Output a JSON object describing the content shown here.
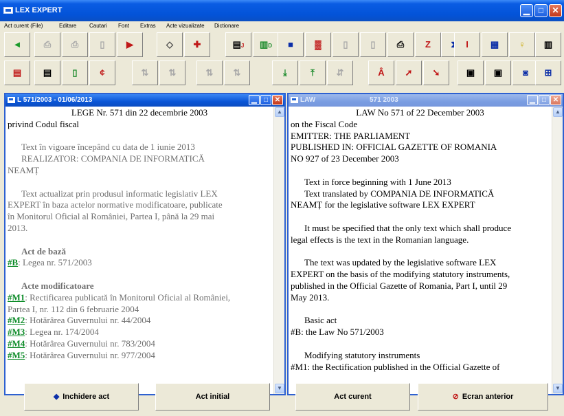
{
  "window": {
    "title": "LEX EXPERT"
  },
  "menu": [
    "Act curent (File)",
    "Editare",
    "Cautari",
    "Font",
    "Extras",
    "Acte vizualizate",
    "Dictionare"
  ],
  "toolbar1": [
    {
      "glyph": "◄",
      "color": "#1a9a2a",
      "dim": false
    },
    {
      "glyph": "⎙",
      "color": "#a8a8a8",
      "dim": true
    },
    {
      "glyph": "⎙",
      "color": "#a8a8a8",
      "dim": true
    },
    {
      "glyph": "▯",
      "color": "#a8a8a8",
      "dim": true
    },
    {
      "glyph": "▶",
      "color": "#c01818",
      "dim": false
    },
    {
      "glyph": "◇",
      "color": "#444444",
      "dim": false
    },
    {
      "glyph": "✚",
      "color": "#c01818",
      "dim": false
    },
    {
      "glyph": "▤",
      "color": "#000000",
      "dim": false,
      "sub": "J"
    },
    {
      "glyph": "▥",
      "color": "#1a8a2a",
      "dim": false,
      "sub": "D"
    },
    {
      "glyph": "■",
      "color": "#0c2fa8",
      "dim": false
    },
    {
      "glyph": "▓",
      "color": "#c01818",
      "dim": false
    },
    {
      "glyph": "▯",
      "color": "#a8a8a8",
      "dim": true
    },
    {
      "glyph": "▯",
      "color": "#a8a8a8",
      "dim": true
    },
    {
      "glyph": "⎙",
      "color": "#000000",
      "dim": false
    },
    {
      "glyph": "Z",
      "color": "#c01818",
      "dim": false
    },
    {
      "glyph": "⧗",
      "color": "#0c2fa8",
      "dim": false
    },
    {
      "glyph": "I",
      "color": "#c01818",
      "dim": false
    },
    {
      "glyph": "▦",
      "color": "#0c2fa8",
      "dim": false
    },
    {
      "glyph": "♀",
      "color": "#c9a700",
      "dim": false
    },
    {
      "glyph": "▥",
      "color": "#000000",
      "dim": false
    }
  ],
  "toolbar2": [
    {
      "glyph": "▤",
      "color": "#c01818",
      "dim": false
    },
    {
      "glyph": "▤",
      "color": "#000000",
      "dim": false
    },
    {
      "glyph": "▯",
      "color": "#1a8a2a",
      "dim": false
    },
    {
      "glyph": "¢",
      "color": "#c01818",
      "dim": false
    },
    {
      "glyph": "⇅",
      "color": "#a8a8a8",
      "dim": true
    },
    {
      "glyph": "⇅",
      "color": "#a8a8a8",
      "dim": true
    },
    {
      "glyph": "⇅",
      "color": "#a8a8a8",
      "dim": true
    },
    {
      "glyph": "⇅",
      "color": "#a8a8a8",
      "dim": true
    },
    {
      "glyph": "⤓",
      "color": "#1a8a2a",
      "dim": false
    },
    {
      "glyph": "⤒",
      "color": "#1a8a2a",
      "dim": false
    },
    {
      "glyph": "⇵",
      "color": "#a8a8a8",
      "dim": true
    },
    {
      "glyph": "Â",
      "color": "#c01818",
      "dim": false
    },
    {
      "glyph": "➚",
      "color": "#c01818",
      "dim": false
    },
    {
      "glyph": "➘",
      "color": "#c01818",
      "dim": false
    },
    {
      "glyph": "▣",
      "color": "#000000",
      "dim": false
    },
    {
      "glyph": "▣",
      "color": "#000000",
      "dim": false
    },
    {
      "glyph": "◙",
      "color": "#0c2fa8",
      "dim": false
    },
    {
      "glyph": "⊞",
      "color": "#0c2fa8",
      "dim": false
    }
  ],
  "left_doc": {
    "title": "L 571/2003 - 01/06/2013",
    "lines": [
      {
        "text": "LEGE   Nr. 571 din 22 decembrie 2003",
        "style": "center"
      },
      {
        "text": "privind Codul fiscal",
        "style": ""
      },
      {
        "text": "",
        "style": ""
      },
      {
        "text": "Text în vigoare începând cu data de 1 iunie 2013",
        "style": "gray indent"
      },
      {
        "text": "REALIZATOR: COMPANIA DE INFORMATICĂ",
        "style": "gray indent"
      },
      {
        "text": "NEAMȚ",
        "style": "gray"
      },
      {
        "text": "",
        "style": ""
      },
      {
        "text": "Text actualizat prin produsul informatic legislativ LEX",
        "style": "gray indent"
      },
      {
        "text": "EXPERT în baza actelor normative modificatoare, publicate",
        "style": "gray"
      },
      {
        "text": "în Monitorul Oficial al României, Partea I, până la 29 mai",
        "style": "gray"
      },
      {
        "text": "2013.",
        "style": "gray"
      },
      {
        "text": "",
        "style": ""
      },
      {
        "text": "Act de bază",
        "style": "bold-gray indent"
      },
      {
        "link": "#B",
        "rest": ": Legea nr. 571/2003"
      },
      {
        "text": "",
        "style": ""
      },
      {
        "text": "Acte modificatoare",
        "style": "bold-gray indent"
      },
      {
        "link": "#M1",
        "rest": ": Rectificarea publicată în Monitorul Oficial al României,"
      },
      {
        "text": "Partea I, nr. 112 din 6 februarie 2004",
        "style": "gray"
      },
      {
        "link": "#M2",
        "rest": ": Hotărârea Guvernului nr. 44/2004"
      },
      {
        "link": "#M3",
        "rest": ": Legea nr. 174/2004"
      },
      {
        "link": "#M4",
        "rest": ": Hotărârea Guvernului nr. 783/2004"
      },
      {
        "link": "#M5",
        "rest": ": Hotărârea Guvernului nr. 977/2004"
      }
    ]
  },
  "right_doc": {
    "title": "LAW",
    "title_number": "571  2003",
    "lines": [
      {
        "text": "LAW   No 571 of 22 December 2003",
        "style": "center"
      },
      {
        "text": "on the Fiscal Code",
        "style": ""
      },
      {
        "text": "EMITTER:     THE PARLIAMENT",
        "style": ""
      },
      {
        "text": "PUBLISHED  IN: OFFICIAL GAZETTE OF ROMANIA",
        "style": ""
      },
      {
        "text": "NO 927 of 23 December 2003",
        "style": ""
      },
      {
        "text": "",
        "style": ""
      },
      {
        "text": "Text in force beginning with 1 June 2013",
        "style": "indent"
      },
      {
        "text": "Text translated by COMPANIA DE INFORMATICĂ",
        "style": "indent"
      },
      {
        "text": "NEAMȚ for the legislative software LEX EXPERT",
        "style": ""
      },
      {
        "text": "",
        "style": ""
      },
      {
        "text": "It must be specified that the only text which shall produce",
        "style": "indent"
      },
      {
        "text": "legal effects is the text in the Romanian language.",
        "style": ""
      },
      {
        "text": "",
        "style": ""
      },
      {
        "text": "The text was updated by the legislative software LEX",
        "style": "indent"
      },
      {
        "text": "EXPERT on the basis of the modifying statutory instruments,",
        "style": ""
      },
      {
        "text": "published in the Official Gazette of Romania, Part I, until 29",
        "style": ""
      },
      {
        "text": "May 2013.",
        "style": ""
      },
      {
        "text": "",
        "style": ""
      },
      {
        "text": "Basic act",
        "style": "indent"
      },
      {
        "text": "#B: the Law No 571/2003",
        "style": ""
      },
      {
        "text": "",
        "style": ""
      },
      {
        "text": "Modifying statutory instruments",
        "style": "indent"
      },
      {
        "text": "#M1: the Rectification published in the Official Gazette of",
        "style": ""
      }
    ]
  },
  "bottom_buttons": [
    {
      "label": "Inchidere act",
      "icon": "◆",
      "icon_color": "#0c2fa8"
    },
    {
      "label": "Act initial",
      "icon": "",
      "icon_color": ""
    },
    {
      "label": "Act curent",
      "icon": "",
      "icon_color": ""
    },
    {
      "label": "Ecran anterior",
      "icon": "⊘",
      "icon_color": "#c01818"
    }
  ]
}
